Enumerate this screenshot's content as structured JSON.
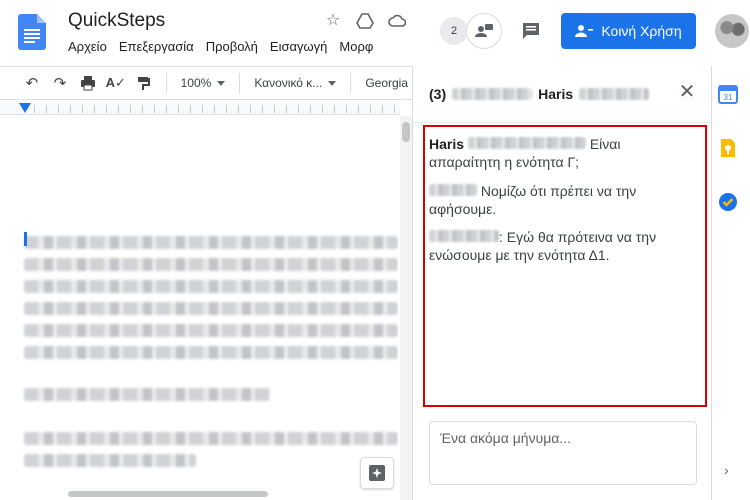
{
  "document": {
    "title": "QuickSteps",
    "menu": [
      "Αρχείο",
      "Επεξεργασία",
      "Προβολή",
      "Εισαγωγή",
      "Μορφ"
    ]
  },
  "toolbar": {
    "zoom": "100%",
    "style": "Κανονικό κ...",
    "font": "Georgia"
  },
  "header": {
    "collaborator_count": "2",
    "share_label": "Κοινή Χρήση"
  },
  "chat": {
    "title_count": "(3)",
    "title_name": "Haris",
    "messages": [
      {
        "sender": "Haris",
        "text": "Είναι απαραίτητη η ενότητα Γ;"
      },
      {
        "sender": "",
        "text": "Νομίζω ότι πρέπει να την αφήσουμε."
      },
      {
        "sender": "",
        "text": ": Εγώ θα πρότεινα να την ενώσουμε με την ενότητα Δ1."
      }
    ],
    "reply_placeholder": "Ένα ακόμα μήνυμα..."
  },
  "side_apps": {
    "calendar_day": "31"
  },
  "colors": {
    "accent": "#1a73e8",
    "highlight_border": "#d50000"
  }
}
